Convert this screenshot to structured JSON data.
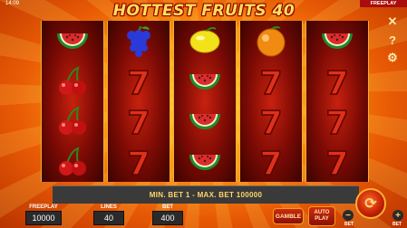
{
  "status_bar": {
    "time": "14:09",
    "mode_tag": "FREEPLAY"
  },
  "game": {
    "title": "HOTTEST FRUITS 40"
  },
  "side_icons": [
    "close-icon",
    "help-icon",
    "settings-icon"
  ],
  "reels": [
    [
      "watermelon",
      "cherry",
      "cherry",
      "cherry"
    ],
    [
      "grapes",
      "seven",
      "seven",
      "seven"
    ],
    [
      "lemon",
      "watermelon",
      "watermelon",
      "watermelon"
    ],
    [
      "orange",
      "seven",
      "seven",
      "seven"
    ],
    [
      "watermelon",
      "seven",
      "seven",
      "seven"
    ]
  ],
  "message": "MIN. BET 1 - MAX. BET 100000",
  "bottom_bar": {
    "freeplay_label": "FREEPLAY",
    "freeplay_value": "10000",
    "lines_label": "LINES",
    "lines_value": "40",
    "bet_label": "BET",
    "bet_value": "400",
    "gamble_label": "GAMBLE",
    "autoplay_label": "AUTO PLAY",
    "bet_minus_label": "BET",
    "bet_plus_label": "BET"
  },
  "colors": {
    "accent": "#ffd23a",
    "reel_bg": "#7a0a04",
    "panel": "#2a2a2a"
  }
}
